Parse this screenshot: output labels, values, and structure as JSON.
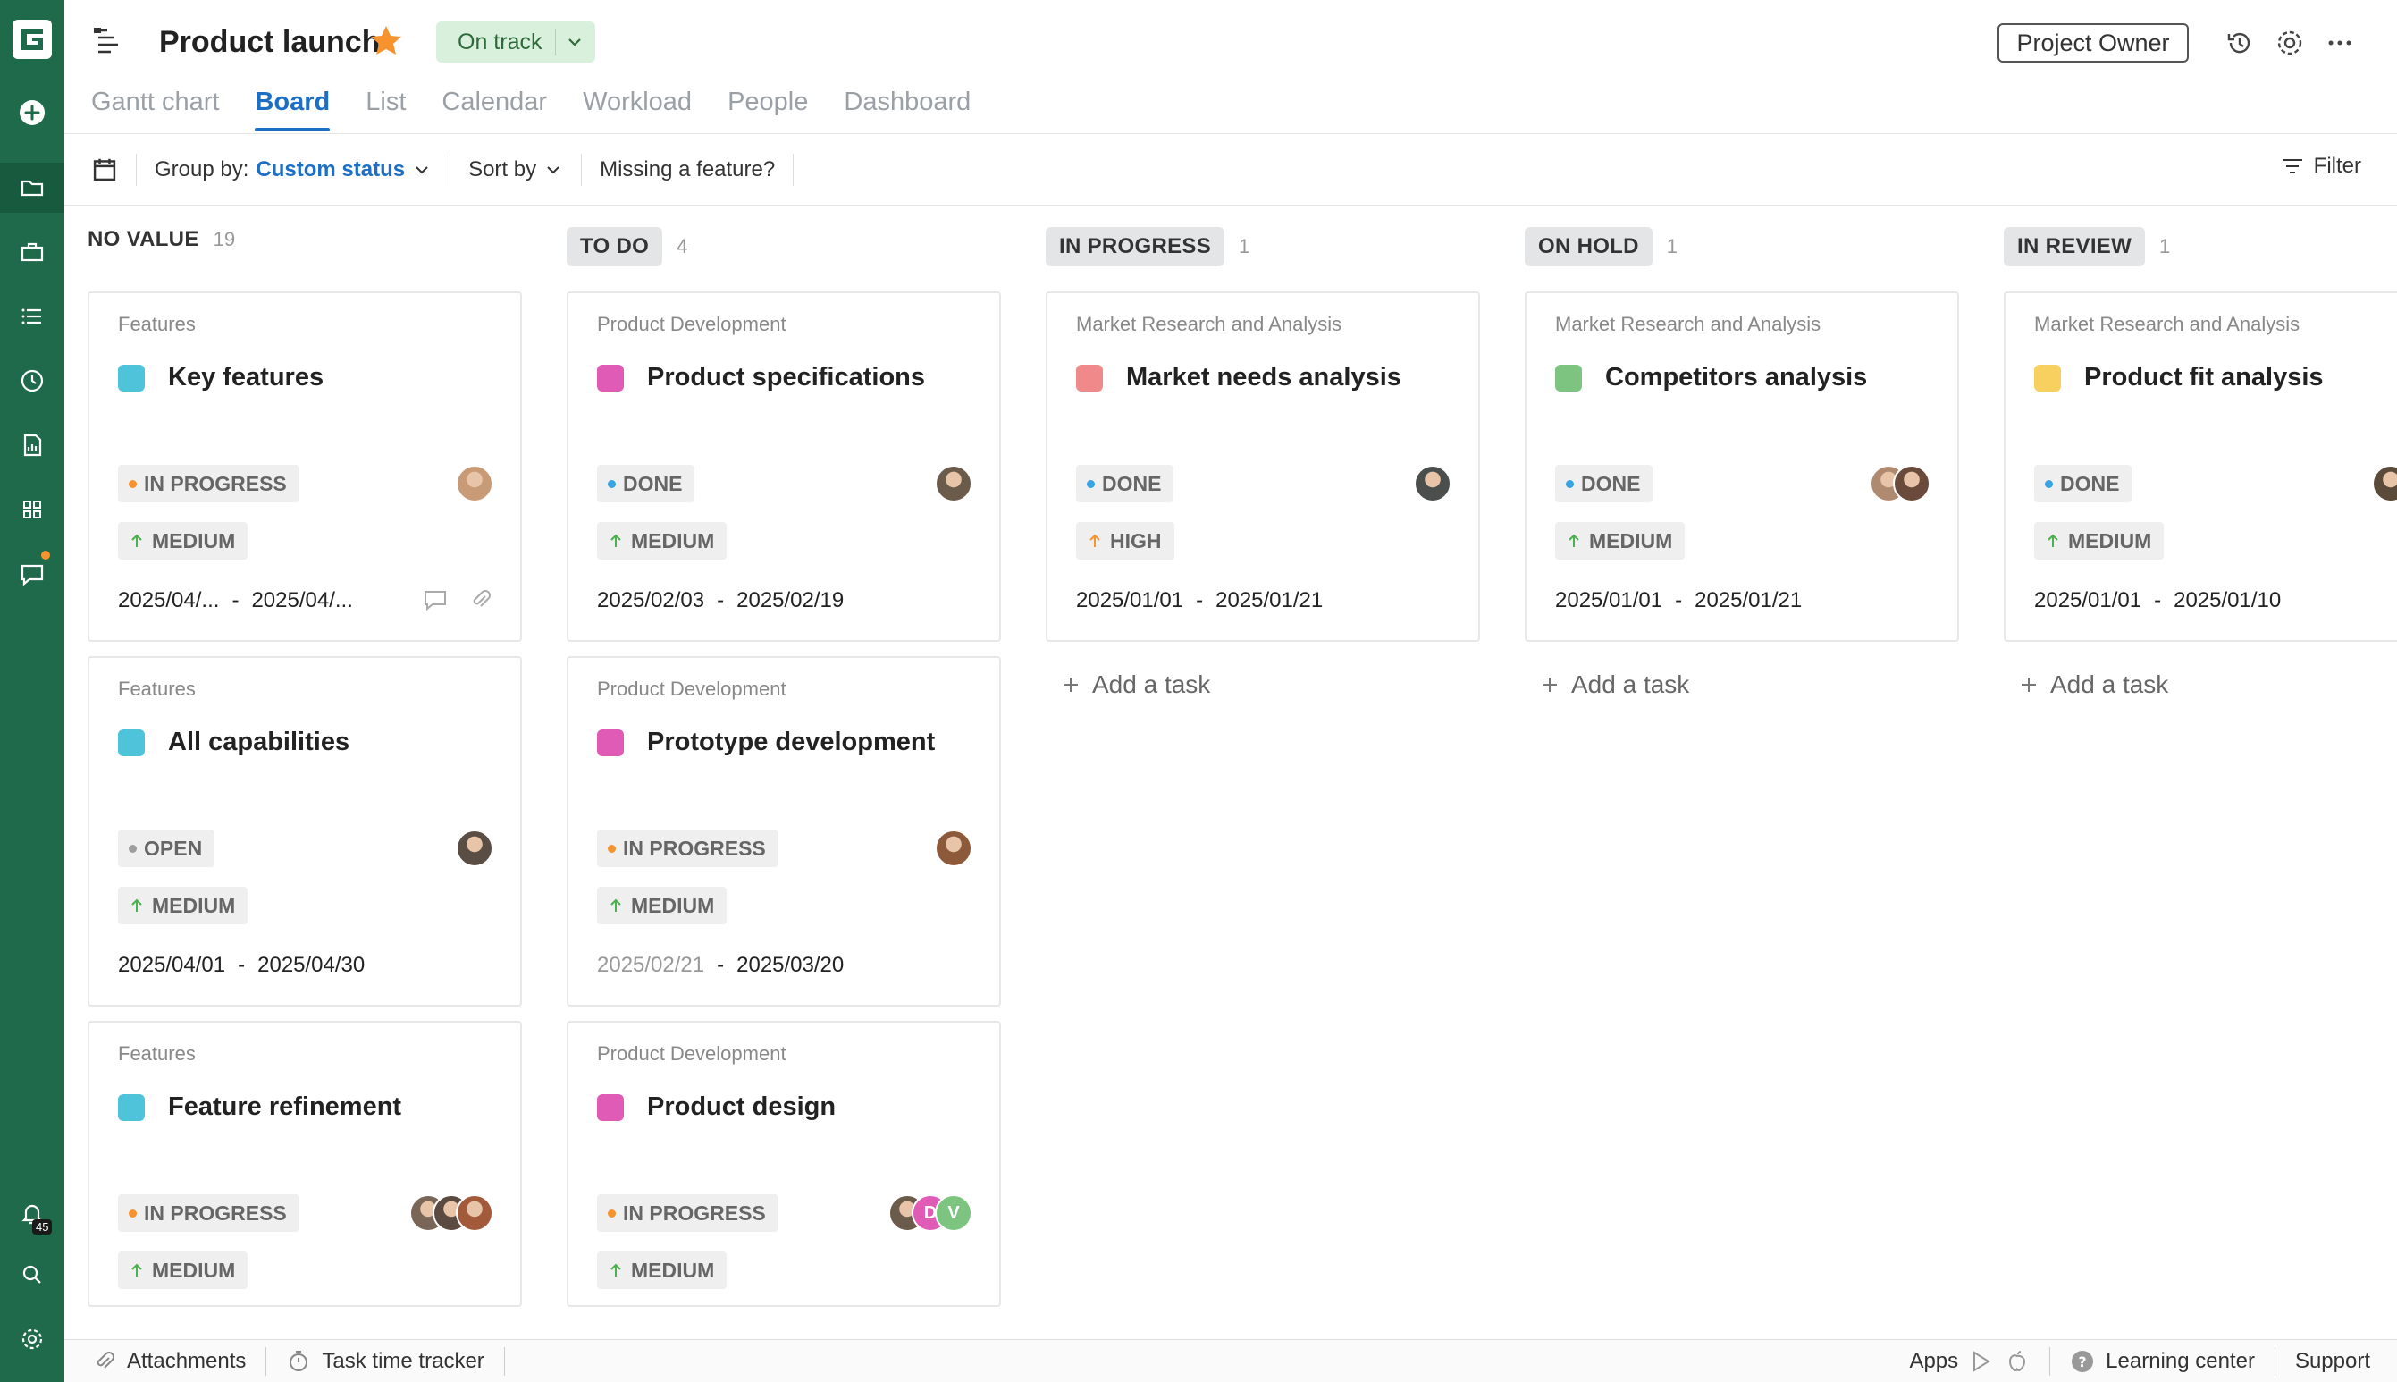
{
  "header": {
    "project_title": "Product launch",
    "status_label": "On track",
    "owner_button": "Project Owner"
  },
  "tabs": [
    {
      "label": "Gantt chart",
      "active": false
    },
    {
      "label": "Board",
      "active": true
    },
    {
      "label": "List",
      "active": false
    },
    {
      "label": "Calendar",
      "active": false
    },
    {
      "label": "Workload",
      "active": false
    },
    {
      "label": "People",
      "active": false
    },
    {
      "label": "Dashboard",
      "active": false
    }
  ],
  "toolbar": {
    "group_by_label": "Group by:",
    "group_by_value": "Custom status",
    "sort_by_label": "Sort by",
    "missing_feature": "Missing a feature?",
    "filter_label": "Filter"
  },
  "sidebar": {
    "notification_count": "45"
  },
  "columns": [
    {
      "title": "NO VALUE",
      "count": "19",
      "pill": false,
      "cards": [
        {
          "group": "Features",
          "title": "Key features",
          "color": "#4fc3d9",
          "status": "IN PROGRESS",
          "status_color": "#f7932f",
          "priority": "MEDIUM",
          "start": "2025/04/...",
          "sep": "-",
          "end": "2025/04/..."
        },
        {
          "group": "Features",
          "title": "All capabilities",
          "color": "#4fc3d9",
          "status": "OPEN",
          "status_color": "#9e9e9e",
          "priority": "MEDIUM",
          "start": "2025/04/01",
          "sep": "-",
          "end": "2025/04/30"
        },
        {
          "group": "Features",
          "title": "Feature refinement",
          "color": "#4fc3d9",
          "status": "IN PROGRESS",
          "status_color": "#f7932f",
          "priority": "MEDIUM"
        }
      ]
    },
    {
      "title": "TO DO",
      "count": "4",
      "pill": true,
      "cards": [
        {
          "group": "Product Development",
          "title": "Product specifications",
          "color": "#e05bb5",
          "status": "DONE",
          "status_color": "#3aa3e3",
          "priority": "MEDIUM",
          "start": "2025/02/03",
          "sep": "-",
          "end": "2025/02/19"
        },
        {
          "group": "Product Development",
          "title": "Prototype development",
          "color": "#e05bb5",
          "status": "IN PROGRESS",
          "status_color": "#f7932f",
          "priority": "MEDIUM",
          "start": "2025/02/21",
          "sep": "-",
          "end": "2025/03/20"
        },
        {
          "group": "Product Development",
          "title": "Product design",
          "color": "#e05bb5",
          "status": "IN PROGRESS",
          "status_color": "#f7932f",
          "priority": "MEDIUM",
          "avatar_letters": [
            "D",
            "V"
          ]
        }
      ]
    },
    {
      "title": "IN PROGRESS",
      "count": "1",
      "pill": true,
      "cards": [
        {
          "group": "Market Research and Analysis",
          "title": "Market needs analysis",
          "color": "#f08a8a",
          "status": "DONE",
          "status_color": "#3aa3e3",
          "priority": "HIGH",
          "start": "2025/01/01",
          "sep": "-",
          "end": "2025/01/21"
        }
      ],
      "add_task": "Add a task"
    },
    {
      "title": "ON HOLD",
      "count": "1",
      "pill": true,
      "cards": [
        {
          "group": "Market Research and Analysis",
          "title": "Competitors analysis",
          "color": "#7cc47f",
          "status": "DONE",
          "status_color": "#3aa3e3",
          "priority": "MEDIUM",
          "start": "2025/01/01",
          "sep": "-",
          "end": "2025/01/21"
        }
      ],
      "add_task": "Add a task"
    },
    {
      "title": "IN REVIEW",
      "count": "1",
      "pill": true,
      "cards": [
        {
          "group": "Market Research and Analysis",
          "title": "Product fit analysis",
          "color": "#f7d060",
          "status": "DONE",
          "status_color": "#3aa3e3",
          "priority": "MEDIUM",
          "start": "2025/01/01",
          "sep": "-",
          "end": "2025/01/10"
        }
      ],
      "add_task": "Add a task"
    }
  ],
  "footer": {
    "attachments": "Attachments",
    "time_tracker": "Task time tracker",
    "apps": "Apps",
    "learning_center": "Learning center",
    "support": "Support"
  }
}
